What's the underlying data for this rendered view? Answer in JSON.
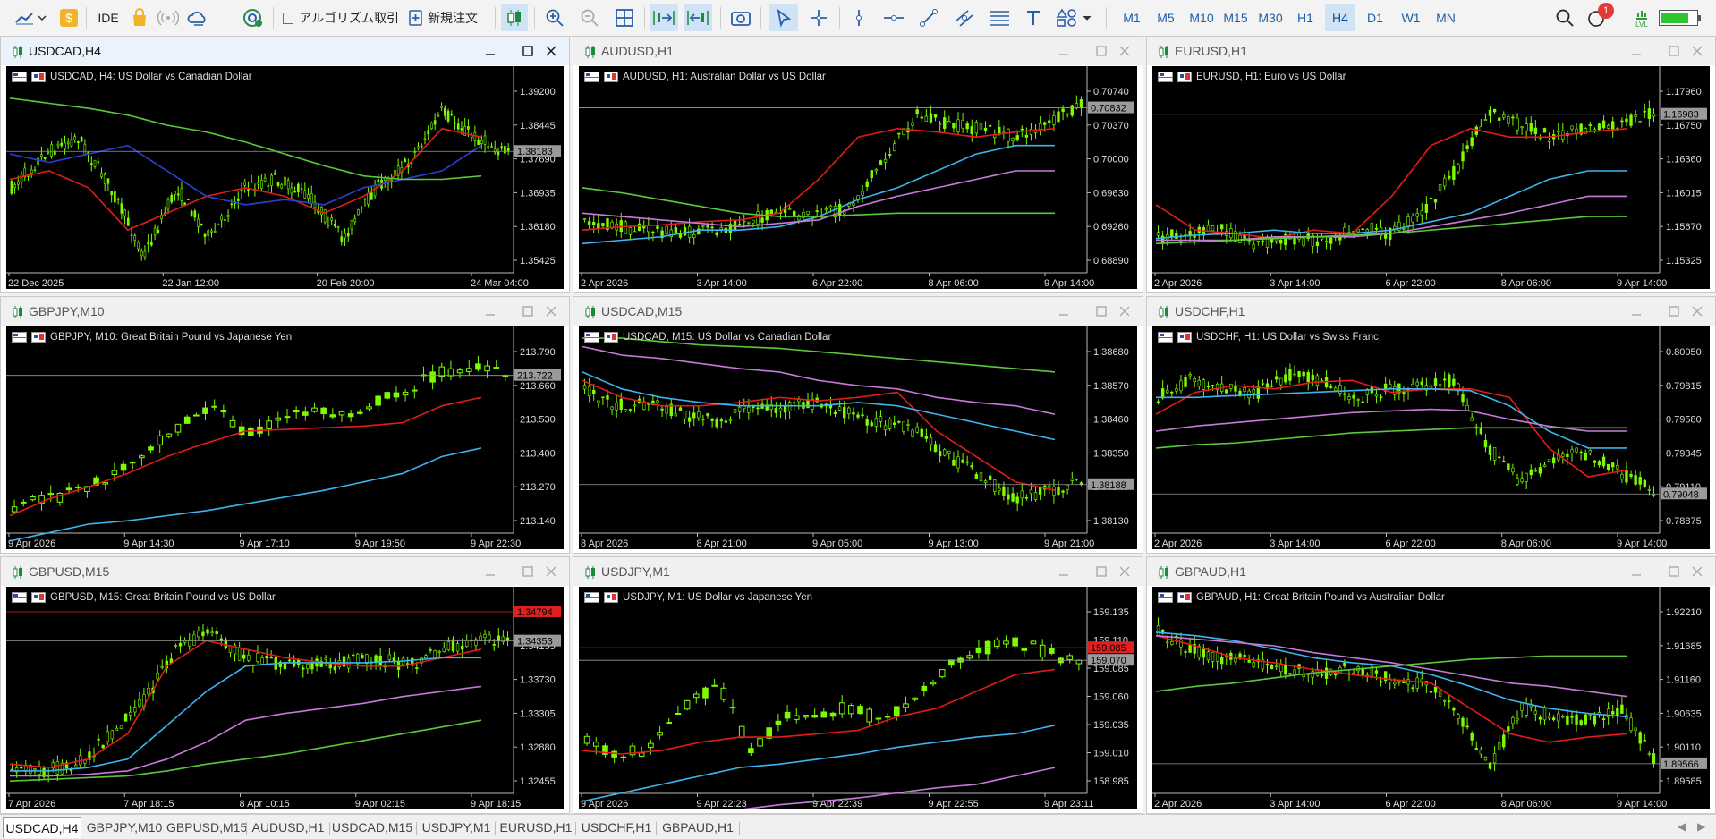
{
  "toolbar": {
    "ide_label": "IDE",
    "algo_label": "アルゴリズム取引",
    "new_order_label": "新規注文",
    "timeframes": [
      "M1",
      "M5",
      "M10",
      "M15",
      "M30",
      "H1",
      "H4",
      "D1",
      "W1",
      "MN"
    ],
    "active_timeframe": "H4",
    "notifications_count": "1",
    "lvl_label": "LVL",
    "battery_level": 0.75
  },
  "windows": [
    {
      "title": "USDCAD,H4",
      "desc": "USDCAD, H4:  US Dollar vs Canadian Dollar",
      "prices": [
        "1.39200",
        "1.38445",
        "1.37690",
        "1.36935",
        "1.36180",
        "1.35425"
      ],
      "current": "1.38183",
      "dates": [
        "22 Dec 2025",
        "22 Jan 12:00",
        "20 Feb 20:00",
        "24 Mar 04:00"
      ]
    },
    {
      "title": "AUDUSD,H1",
      "desc": "AUDUSD, H1:  Australian Dollar vs US Dollar",
      "prices": [
        "0.70740",
        "0.70370",
        "0.70000",
        "0.69630",
        "0.69260",
        "0.68890"
      ],
      "current": "0.70832",
      "dates": [
        "2 Apr 2026",
        "3 Apr 14:00",
        "6 Apr 22:00",
        "8 Apr 06:00",
        "9 Apr 14:00"
      ]
    },
    {
      "title": "EURUSD,H1",
      "desc": "EURUSD, H1:  Euro vs US Dollar",
      "prices": [
        "1.17960",
        "1.16750",
        "1.16360",
        "1.16015",
        "1.15670",
        "1.15325"
      ],
      "current": "1.16983",
      "dates": [
        "2 Apr 2026",
        "3 Apr 14:00",
        "6 Apr 22:00",
        "8 Apr 06:00",
        "9 Apr 14:00"
      ]
    },
    {
      "title": "GBPJPY,M10",
      "desc": "GBPJPY, M10:  Great Britain Pound vs Japanese Yen",
      "prices": [
        "213.790",
        "213.660",
        "213.530",
        "213.400",
        "213.270",
        "213.140"
      ],
      "current": "213.722",
      "dates": [
        "9 Apr 2026",
        "9 Apr 14:30",
        "9 Apr 17:10",
        "9 Apr 19:50",
        "9 Apr 22:30"
      ]
    },
    {
      "title": "USDCAD,M15",
      "desc": "USDCAD, M15:  US Dollar vs Canadian Dollar",
      "prices": [
        "1.38680",
        "1.38570",
        "1.38460",
        "1.38350",
        "1.38240",
        "1.38130"
      ],
      "current": "1.38188",
      "dates": [
        "8 Apr 2026",
        "8 Apr 21:00",
        "9 Apr 05:00",
        "9 Apr 13:00",
        "9 Apr 21:00"
      ]
    },
    {
      "title": "USDCHF,H1",
      "desc": "USDCHF, H1:  US Dollar vs Swiss Franc",
      "prices": [
        "0.80050",
        "0.79815",
        "0.79580",
        "0.79345",
        "0.79110",
        "0.78875"
      ],
      "current": "0.79048",
      "dates": [
        "2 Apr 2026",
        "3 Apr 14:00",
        "6 Apr 22:00",
        "8 Apr 06:00",
        "9 Apr 14:00"
      ]
    },
    {
      "title": "GBPUSD,M15",
      "desc": "GBPUSD, M15:  Great Britain Pound vs US Dollar",
      "prices": [
        "1.34580",
        "1.34155",
        "1.33730",
        "1.33305",
        "1.32880",
        "1.32455"
      ],
      "current": "1.34353",
      "current2": "1.34794",
      "dates": [
        "7 Apr 2026",
        "7 Apr 18:15",
        "8 Apr 10:15",
        "9 Apr 02:15",
        "9 Apr 18:15"
      ]
    },
    {
      "title": "USDJPY,M1",
      "desc": "USDJPY, M1:  US Dollar vs Japanese Yen",
      "prices": [
        "159.135",
        "159.110",
        "159.085",
        "159.060",
        "159.035",
        "159.010",
        "158.985"
      ],
      "current": "159.070",
      "current2": "159.085",
      "dates": [
        "9 Apr 2026",
        "9 Apr 22:23",
        "9 Apr 22:39",
        "9 Apr 22:55",
        "9 Apr 23:11"
      ]
    },
    {
      "title": "GBPAUD,H1",
      "desc": "GBPAUD, H1:  Great Britain Pound vs Australian Dollar",
      "prices": [
        "1.92210",
        "1.91685",
        "1.91160",
        "1.90635",
        "1.90110",
        "1.89585"
      ],
      "current": "1.89566",
      "dates": [
        "2 Apr 2026",
        "3 Apr 14:00",
        "6 Apr 22:00",
        "8 Apr 06:00",
        "9 Apr 14:00"
      ]
    }
  ],
  "tabs": [
    "USDCAD,H4",
    "GBPJPY,M10",
    "GBPUSD,M15",
    "AUDUSD,H1",
    "USDCAD,M15",
    "USDJPY,M1",
    "EURUSD,H1",
    "USDCHF,H1",
    "GBPAUD,H1"
  ],
  "active_tab": "USDCAD,H4",
  "colors": {
    "bull": "#7CFC00",
    "ma_red": "#e41b1b",
    "ma_blue": "#2b3fd6",
    "ma_sky": "#3cb4f0",
    "ma_violet": "#c77ad8",
    "ma_green": "#5bc83a",
    "label_bg": "#9a9a9a",
    "label_red": "#e02020"
  }
}
